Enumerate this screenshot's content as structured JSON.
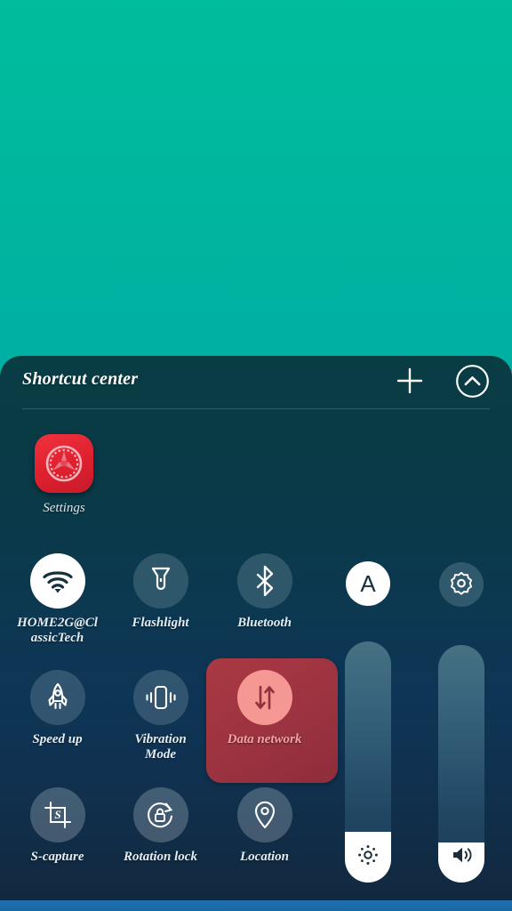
{
  "wallpaper": {
    "top_color": "#00bd9d",
    "bottom_color": "#0091ab"
  },
  "panel": {
    "title": "Shortcut center",
    "background_color": "#093d44",
    "add_icon": "plus-icon",
    "collapse_icon": "chevron-up-circle-icon"
  },
  "apps": [
    {
      "label": "Settings",
      "icon": "gear-app-icon",
      "color": "#e0212f"
    }
  ],
  "toggles": [
    {
      "label": "HOME2G@ClassicTech",
      "label_line1": "HOME2G@Cl",
      "label_line2": "assicTech",
      "icon": "wifi-icon",
      "state": "on"
    },
    {
      "label": "Flashlight",
      "icon": "flashlight-icon",
      "state": "off"
    },
    {
      "label": "Bluetooth",
      "icon": "bluetooth-icon",
      "state": "off"
    },
    {
      "label": "Speed up",
      "icon": "rocket-icon",
      "state": "off"
    },
    {
      "label": "Vibration Mode",
      "label_line1": "Vibration",
      "label_line2": "Mode",
      "icon": "vibration-icon",
      "state": "off"
    },
    {
      "label": "Data network",
      "icon": "data-transfer-icon",
      "state": "on",
      "highlight_color": "#9c3340",
      "accent_color": "#f59894"
    },
    {
      "label": "S-capture",
      "icon": "screen-capture-icon",
      "state": "off"
    },
    {
      "label": "Rotation lock",
      "icon": "rotation-lock-icon",
      "state": "off"
    },
    {
      "label": "Location",
      "icon": "location-pin-icon",
      "state": "off"
    }
  ],
  "controls": {
    "auto_brightness": {
      "label": "A",
      "icon": "auto-brightness-icon",
      "state": "on"
    },
    "settings_shortcut": {
      "icon": "gear-icon",
      "state": "off"
    },
    "brightness_slider": {
      "icon": "brightness-icon",
      "value": 21,
      "min": 0,
      "max": 100
    },
    "volume_slider": {
      "icon": "volume-icon",
      "value": 17,
      "min": 0,
      "max": 100
    }
  },
  "navbar": {
    "color": "#1a68a6"
  }
}
